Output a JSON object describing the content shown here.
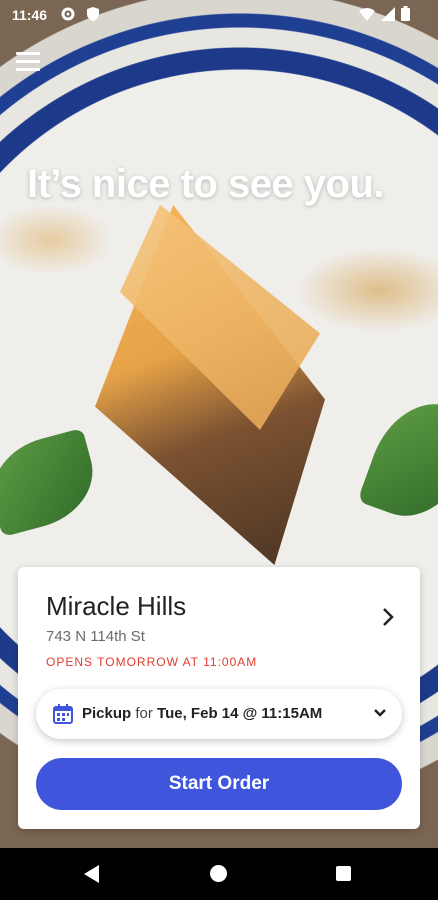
{
  "status_bar": {
    "time": "11:46",
    "left_icons": [
      "gear-icon",
      "shield-icon"
    ],
    "right_icons": [
      "wifi-icon",
      "signal-icon",
      "battery-icon"
    ]
  },
  "header": {
    "menu_icon": "hamburger-menu-icon",
    "headline": "It’s nice to see you."
  },
  "store": {
    "name": "Miracle Hills",
    "address": "743 N 114th St",
    "status": "OPENS TOMORROW AT 11:00AM"
  },
  "pickup": {
    "mode": "Pickup",
    "connector": "for",
    "datetime": "Tue, Feb 14 @ 11:15AM"
  },
  "actions": {
    "start_order": "Start Order"
  },
  "colors": {
    "accent": "#3f56dc",
    "status_red": "#e23b2d"
  }
}
